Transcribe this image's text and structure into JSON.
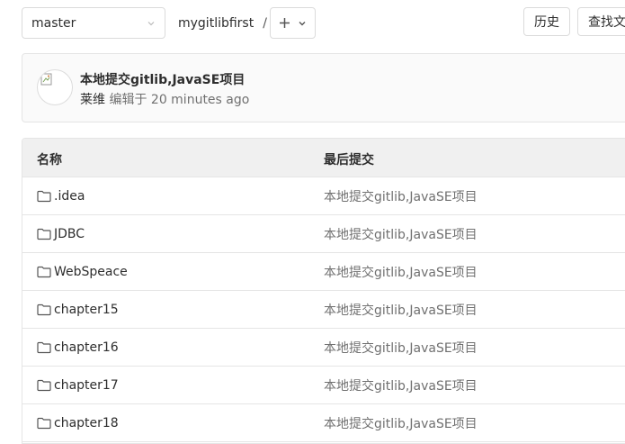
{
  "toolbar": {
    "branch": "master",
    "project": "mygitlibfirst",
    "separator": "/",
    "add_icon": "plus-icon",
    "history_label": "历史",
    "find_file_label": "查找文件"
  },
  "last_commit": {
    "title": "本地提交gitlib,JavaSE项目",
    "author": "莱维",
    "edited_label": "编辑于",
    "time": "20 minutes ago"
  },
  "file_table": {
    "headers": {
      "name": "名称",
      "last_commit": "最后提交"
    },
    "rows": [
      {
        "name": ".idea",
        "commit": "本地提交gitlib,JavaSE项目",
        "icon": "folder-icon"
      },
      {
        "name": "JDBC",
        "commit": "本地提交gitlib,JavaSE项目",
        "icon": "folder-icon"
      },
      {
        "name": "WebSpeace",
        "commit": "本地提交gitlib,JavaSE项目",
        "icon": "folder-icon"
      },
      {
        "name": "chapter15",
        "commit": "本地提交gitlib,JavaSE项目",
        "icon": "folder-icon"
      },
      {
        "name": "chapter16",
        "commit": "本地提交gitlib,JavaSE项目",
        "icon": "folder-icon"
      },
      {
        "name": "chapter17",
        "commit": "本地提交gitlib,JavaSE项目",
        "icon": "folder-icon"
      },
      {
        "name": "chapter18",
        "commit": "本地提交gitlib,JavaSE项目",
        "icon": "folder-icon"
      }
    ]
  }
}
